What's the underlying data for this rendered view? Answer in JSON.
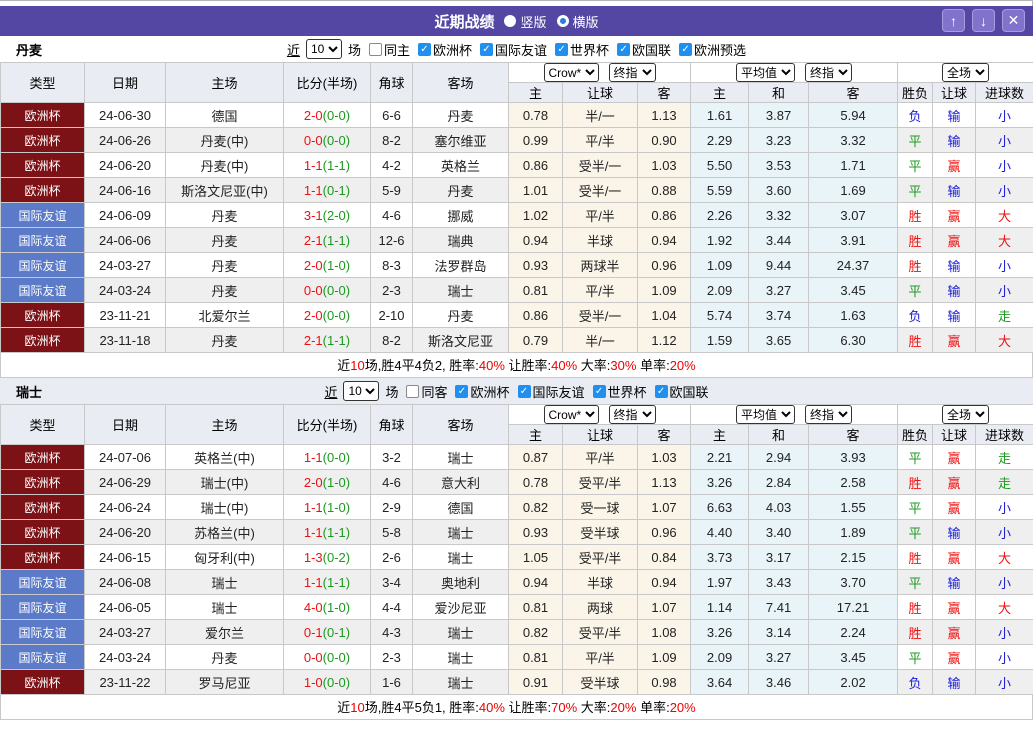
{
  "titlebar": {
    "title": "近期战绩",
    "radio_vertical": "竖版",
    "radio_horizontal": "横版",
    "icons": {
      "up": "↑",
      "down": "↓",
      "close": "✕"
    }
  },
  "columns": {
    "type": "类型",
    "date": "日期",
    "home": "主场",
    "score": "比分(半场)",
    "corner": "角球",
    "away": "客场",
    "h_home": "主",
    "h_line": "让球",
    "h_away": "客",
    "a_home": "主",
    "a_draw": "和",
    "a_away": "客",
    "wdl": "胜负",
    "rq": "让球",
    "goals": "进球数"
  },
  "selects": {
    "company": "Crow*",
    "final": "终指",
    "average": "平均值",
    "full": "全场"
  },
  "sections": [
    {
      "team": "丹麦",
      "filter": {
        "prefix": "近",
        "count": "10",
        "suffix": "场",
        "same": "同主",
        "leagues": [
          "欧洲杯",
          "国际友谊",
          "世界杯",
          "欧国联",
          "欧洲预选"
        ]
      },
      "rows": [
        {
          "lg": "欧洲杯",
          "lgc": "cup",
          "date": "24-06-30",
          "home": "德国",
          "hg": false,
          "score": "2-0",
          "half": "(0-0)",
          "cn": "6-6",
          "away": "丹麦",
          "ag": true,
          "ho": [
            "0.78",
            "半/一",
            "1.13"
          ],
          "ao": [
            "1.61",
            "3.87",
            "5.94"
          ],
          "res": [
            [
              "负",
              "b"
            ],
            [
              "输",
              "b"
            ],
            [
              "小",
              "b"
            ]
          ]
        },
        {
          "lg": "欧洲杯",
          "lgc": "cup",
          "date": "24-06-26",
          "home": "丹麦(中)",
          "hg": true,
          "score": "0-0",
          "half": "(0-0)",
          "cn": "8-2",
          "away": "塞尔维亚",
          "ag": false,
          "ho": [
            "0.99",
            "平/半",
            "0.90"
          ],
          "ao": [
            "2.29",
            "3.23",
            "3.32"
          ],
          "res": [
            [
              "平",
              "g"
            ],
            [
              "输",
              "b"
            ],
            [
              "小",
              "b"
            ]
          ]
        },
        {
          "lg": "欧洲杯",
          "lgc": "cup",
          "date": "24-06-20",
          "home": "丹麦(中)",
          "hg": true,
          "score": "1-1",
          "half": "(1-1)",
          "cn": "4-2",
          "away": "英格兰",
          "ag": false,
          "ho": [
            "0.86",
            "受半/一",
            "1.03"
          ],
          "ao": [
            "5.50",
            "3.53",
            "1.71"
          ],
          "res": [
            [
              "平",
              "g"
            ],
            [
              "赢",
              "r"
            ],
            [
              "小",
              "b"
            ]
          ]
        },
        {
          "lg": "欧洲杯",
          "lgc": "cup",
          "date": "24-06-16",
          "home": "斯洛文尼亚(中)",
          "hg": false,
          "score": "1-1",
          "half": "(0-1)",
          "cn": "5-9",
          "away": "丹麦",
          "ag": true,
          "ho": [
            "1.01",
            "受半/一",
            "0.88"
          ],
          "ao": [
            "5.59",
            "3.60",
            "1.69"
          ],
          "res": [
            [
              "平",
              "g"
            ],
            [
              "输",
              "b"
            ],
            [
              "小",
              "b"
            ]
          ]
        },
        {
          "lg": "国际友谊",
          "lgc": "fr",
          "date": "24-06-09",
          "home": "丹麦",
          "hg": true,
          "score": "3-1",
          "half": "(2-0)",
          "cn": "4-6",
          "away": "挪威",
          "ag": false,
          "ho": [
            "1.02",
            "平/半",
            "0.86"
          ],
          "ao": [
            "2.26",
            "3.32",
            "3.07"
          ],
          "res": [
            [
              "胜",
              "r"
            ],
            [
              "赢",
              "r"
            ],
            [
              "大",
              "r"
            ]
          ]
        },
        {
          "lg": "国际友谊",
          "lgc": "fr",
          "date": "24-06-06",
          "home": "丹麦",
          "hg": true,
          "score": "2-1",
          "half": "(1-1)",
          "cn": "12-6",
          "away": "瑞典",
          "ag": false,
          "ho": [
            "0.94",
            "半球",
            "0.94"
          ],
          "ao": [
            "1.92",
            "3.44",
            "3.91"
          ],
          "res": [
            [
              "胜",
              "r"
            ],
            [
              "赢",
              "r"
            ],
            [
              "大",
              "r"
            ]
          ]
        },
        {
          "lg": "国际友谊",
          "lgc": "fr",
          "date": "24-03-27",
          "home": "丹麦",
          "hg": true,
          "score": "2-0",
          "half": "(1-0)",
          "cn": "8-3",
          "away": "法罗群岛",
          "ag": false,
          "ho": [
            "0.93",
            "两球半",
            "0.96"
          ],
          "ao": [
            "1.09",
            "9.44",
            "24.37"
          ],
          "res": [
            [
              "胜",
              "r"
            ],
            [
              "输",
              "b"
            ],
            [
              "小",
              "b"
            ]
          ]
        },
        {
          "lg": "国际友谊",
          "lgc": "fr",
          "date": "24-03-24",
          "home": "丹麦",
          "hg": true,
          "score": "0-0",
          "half": "(0-0)",
          "cn": "2-3",
          "away": "瑞士",
          "ag": false,
          "ho": [
            "0.81",
            "平/半",
            "1.09"
          ],
          "ao": [
            "2.09",
            "3.27",
            "3.45"
          ],
          "res": [
            [
              "平",
              "g"
            ],
            [
              "输",
              "b"
            ],
            [
              "小",
              "b"
            ]
          ]
        },
        {
          "lg": "欧洲杯",
          "lgc": "cup",
          "date": "23-11-21",
          "home": "北爱尔兰",
          "hg": false,
          "score": "2-0",
          "half": "(0-0)",
          "cn": "2-10",
          "away": "丹麦",
          "ag": true,
          "ho": [
            "0.86",
            "受半/一",
            "1.04"
          ],
          "ao": [
            "5.74",
            "3.74",
            "1.63"
          ],
          "res": [
            [
              "负",
              "b"
            ],
            [
              "输",
              "b"
            ],
            [
              "走",
              "g"
            ]
          ]
        },
        {
          "lg": "欧洲杯",
          "lgc": "cup",
          "date": "23-11-18",
          "home": "丹麦",
          "hg": true,
          "score": "2-1",
          "half": "(1-1)",
          "cn": "8-2",
          "away": "斯洛文尼亚",
          "ag": false,
          "ho": [
            "0.79",
            "半/一",
            "1.12"
          ],
          "ao": [
            "1.59",
            "3.65",
            "6.30"
          ],
          "res": [
            [
              "胜",
              "r"
            ],
            [
              "赢",
              "r"
            ],
            [
              "大",
              "r"
            ]
          ]
        }
      ],
      "summary": [
        {
          "t": "近",
          "c": "k"
        },
        {
          "t": "10",
          "c": "r"
        },
        {
          "t": "场,胜4平4负2, 胜率:",
          "c": "k"
        },
        {
          "t": "40%",
          "c": "r"
        },
        {
          "t": " 让胜率:",
          "c": "k"
        },
        {
          "t": "40%",
          "c": "r"
        },
        {
          "t": " 大率:",
          "c": "k"
        },
        {
          "t": "30%",
          "c": "r"
        },
        {
          "t": " 单率:",
          "c": "k"
        },
        {
          "t": "20%",
          "c": "r"
        }
      ]
    },
    {
      "team": "瑞士",
      "filter": {
        "prefix": "近",
        "count": "10",
        "suffix": "场",
        "same": "同客",
        "leagues": [
          "欧洲杯",
          "国际友谊",
          "世界杯",
          "欧国联"
        ]
      },
      "rows": [
        {
          "lg": "欧洲杯",
          "lgc": "cup",
          "date": "24-07-06",
          "home": "英格兰(中)",
          "hg": false,
          "score": "1-1",
          "half": "(0-0)",
          "cn": "3-2",
          "away": "瑞士",
          "ag": true,
          "ho": [
            "0.87",
            "平/半",
            "1.03"
          ],
          "ao": [
            "2.21",
            "2.94",
            "3.93"
          ],
          "res": [
            [
              "平",
              "g"
            ],
            [
              "赢",
              "r"
            ],
            [
              "走",
              "g"
            ]
          ]
        },
        {
          "lg": "欧洲杯",
          "lgc": "cup",
          "date": "24-06-29",
          "home": "瑞士(中)",
          "hg": true,
          "score": "2-0",
          "half": "(1-0)",
          "cn": "4-6",
          "away": "意大利",
          "ag": false,
          "ho": [
            "0.78",
            "受平/半",
            "1.13"
          ],
          "ao": [
            "3.26",
            "2.84",
            "2.58"
          ],
          "res": [
            [
              "胜",
              "r"
            ],
            [
              "赢",
              "r"
            ],
            [
              "走",
              "g"
            ]
          ]
        },
        {
          "lg": "欧洲杯",
          "lgc": "cup",
          "date": "24-06-24",
          "home": "瑞士(中)",
          "hg": true,
          "score": "1-1",
          "half": "(1-0)",
          "cn": "2-9",
          "away": "德国",
          "ag": false,
          "ho": [
            "0.82",
            "受一球",
            "1.07"
          ],
          "ao": [
            "6.63",
            "4.03",
            "1.55"
          ],
          "res": [
            [
              "平",
              "g"
            ],
            [
              "赢",
              "r"
            ],
            [
              "小",
              "b"
            ]
          ]
        },
        {
          "lg": "欧洲杯",
          "lgc": "cup",
          "date": "24-06-20",
          "home": "苏格兰(中)",
          "hg": false,
          "score": "1-1",
          "half": "(1-1)",
          "cn": "5-8",
          "away": "瑞士",
          "ag": true,
          "ho": [
            "0.93",
            "受半球",
            "0.96"
          ],
          "ao": [
            "4.40",
            "3.40",
            "1.89"
          ],
          "res": [
            [
              "平",
              "g"
            ],
            [
              "输",
              "b"
            ],
            [
              "小",
              "b"
            ]
          ]
        },
        {
          "lg": "欧洲杯",
          "lgc": "cup",
          "date": "24-06-15",
          "home": "匈牙利(中)",
          "hg": false,
          "score": "1-3",
          "half": "(0-2)",
          "cn": "2-6",
          "away": "瑞士",
          "ag": true,
          "ho": [
            "1.05",
            "受平/半",
            "0.84"
          ],
          "ao": [
            "3.73",
            "3.17",
            "2.15"
          ],
          "res": [
            [
              "胜",
              "r"
            ],
            [
              "赢",
              "r"
            ],
            [
              "大",
              "r"
            ]
          ]
        },
        {
          "lg": "国际友谊",
          "lgc": "fr",
          "date": "24-06-08",
          "home": "瑞士",
          "hg": true,
          "score": "1-1",
          "half": "(1-1)",
          "cn": "3-4",
          "away": "奥地利",
          "ag": false,
          "ho": [
            "0.94",
            "半球",
            "0.94"
          ],
          "ao": [
            "1.97",
            "3.43",
            "3.70"
          ],
          "res": [
            [
              "平",
              "g"
            ],
            [
              "输",
              "b"
            ],
            [
              "小",
              "b"
            ]
          ]
        },
        {
          "lg": "国际友谊",
          "lgc": "fr",
          "date": "24-06-05",
          "home": "瑞士",
          "hg": true,
          "score": "4-0",
          "half": "(1-0)",
          "cn": "4-4",
          "away": "爱沙尼亚",
          "ag": false,
          "ho": [
            "0.81",
            "两球",
            "1.07"
          ],
          "ao": [
            "1.14",
            "7.41",
            "17.21"
          ],
          "res": [
            [
              "胜",
              "r"
            ],
            [
              "赢",
              "r"
            ],
            [
              "大",
              "r"
            ]
          ]
        },
        {
          "lg": "国际友谊",
          "lgc": "fr",
          "date": "24-03-27",
          "home": "爱尔兰",
          "hg": false,
          "score": "0-1",
          "half": "(0-1)",
          "cn": "4-3",
          "away": "瑞士",
          "ag": true,
          "ho": [
            "0.82",
            "受平/半",
            "1.08"
          ],
          "ao": [
            "3.26",
            "3.14",
            "2.24"
          ],
          "res": [
            [
              "胜",
              "r"
            ],
            [
              "赢",
              "r"
            ],
            [
              "小",
              "b"
            ]
          ]
        },
        {
          "lg": "国际友谊",
          "lgc": "fr",
          "date": "24-03-24",
          "home": "丹麦",
          "hg": false,
          "score": "0-0",
          "half": "(0-0)",
          "cn": "2-3",
          "away": "瑞士",
          "ag": true,
          "ho": [
            "0.81",
            "平/半",
            "1.09"
          ],
          "ao": [
            "2.09",
            "3.27",
            "3.45"
          ],
          "res": [
            [
              "平",
              "g"
            ],
            [
              "赢",
              "r"
            ],
            [
              "小",
              "b"
            ]
          ]
        },
        {
          "lg": "欧洲杯",
          "lgc": "cup",
          "date": "23-11-22",
          "home": "罗马尼亚",
          "hg": false,
          "score": "1-0",
          "half": "(0-0)",
          "cn": "1-6",
          "away": "瑞士",
          "ag": true,
          "ho": [
            "0.91",
            "受半球",
            "0.98"
          ],
          "ao": [
            "3.64",
            "3.46",
            "2.02"
          ],
          "res": [
            [
              "负",
              "b"
            ],
            [
              "输",
              "b"
            ],
            [
              "小",
              "b"
            ]
          ]
        }
      ],
      "summary": [
        {
          "t": "近",
          "c": "k"
        },
        {
          "t": "10",
          "c": "r"
        },
        {
          "t": "场,胜4平5负1, 胜率:",
          "c": "k"
        },
        {
          "t": "40%",
          "c": "r"
        },
        {
          "t": " 让胜率:",
          "c": "k"
        },
        {
          "t": "70%",
          "c": "r"
        },
        {
          "t": " 大率:",
          "c": "k"
        },
        {
          "t": "20%",
          "c": "r"
        },
        {
          "t": " 单率:",
          "c": "k"
        },
        {
          "t": "20%",
          "c": "r"
        }
      ]
    }
  ]
}
